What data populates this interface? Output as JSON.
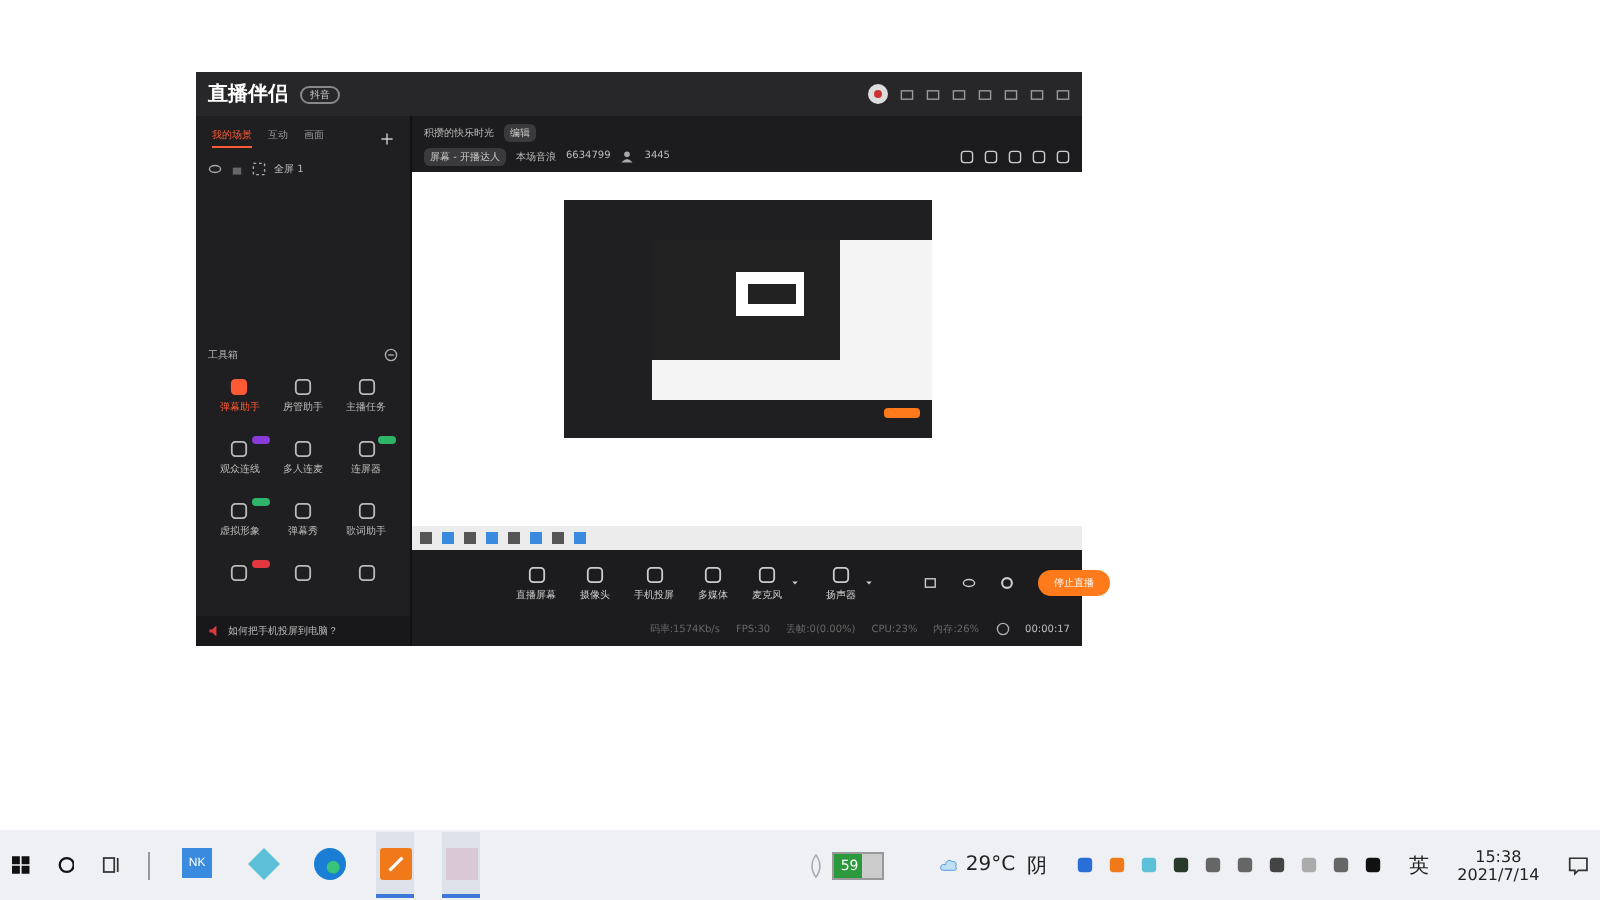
{
  "app": {
    "title": "直播伴侣",
    "version_badge": "抖音",
    "left_tabs": [
      {
        "label": "我的场景",
        "selected": true
      },
      {
        "label": "互动",
        "selected": false
      },
      {
        "label": "画面",
        "selected": false
      }
    ],
    "scenes": [
      {
        "label": "全屏 1",
        "visible": true
      }
    ],
    "toolbox": {
      "title": "工具箱",
      "tools": [
        {
          "label": "弹幕助手",
          "selected": true
        },
        {
          "label": "房管助手",
          "selected": false
        },
        {
          "label": "主播任务",
          "selected": false
        },
        {
          "label": "观众连线",
          "selected": false,
          "color": "#8a3ad8"
        },
        {
          "label": "多人连麦",
          "selected": false
        },
        {
          "label": "连屏器",
          "selected": false,
          "color": "#2fb56a"
        },
        {
          "label": "虚拟形象",
          "selected": false,
          "color": "#2fb56a"
        },
        {
          "label": "弹幕秀",
          "selected": false
        },
        {
          "label": "歌词助手",
          "selected": false
        },
        {
          "selected": false,
          "color": "#e0383e"
        },
        {
          "selected": false
        },
        {
          "selected": false
        }
      ]
    },
    "tip": "如何把手机投屏到电脑？",
    "header": {
      "title": "积攒的快乐时光",
      "edit_label": "编辑",
      "source": "屏幕 - 开播达人",
      "stat_label": "本场音浪",
      "stat_value": "6634799",
      "viewers": "3445"
    },
    "controls": [
      {
        "label": "直播屏幕",
        "kind": "button"
      },
      {
        "label": "摄像头",
        "kind": "button"
      },
      {
        "label": "手机投屏",
        "kind": "button"
      },
      {
        "label": "多媒体",
        "kind": "button"
      },
      {
        "label": "麦克风",
        "kind": "dropdown"
      },
      {
        "label": "扬声器",
        "kind": "dropdown"
      }
    ],
    "stop_button": "停止直播",
    "status": [
      "码率:1574Kb/s",
      "FPS:30",
      "丢帧:0(0.00%)",
      "CPU:23%",
      "内存:26%"
    ],
    "timer": "00:00:17"
  },
  "taskbar": {
    "apps": [
      {
        "kind": "nk",
        "label": "NK",
        "active": false
      },
      {
        "kind": "diamond",
        "active": false
      },
      {
        "kind": "browser",
        "active": false
      },
      {
        "kind": "orange",
        "active": true
      },
      {
        "kind": "photo",
        "active": true
      }
    ],
    "battery": {
      "label": "59",
      "level": 0.59
    },
    "weather": "29°C",
    "weather_text": "阴",
    "ime": "英",
    "time": "15:38",
    "date": "2021/7/14"
  }
}
